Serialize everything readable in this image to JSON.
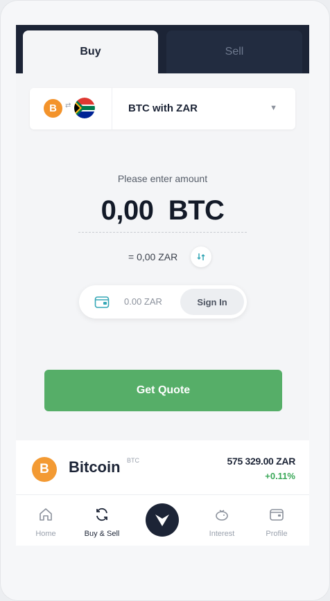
{
  "tabs": {
    "buy": "Buy",
    "sell": "Sell",
    "active": "buy"
  },
  "pair": {
    "base_symbol": "B",
    "label": "BTC with ZAR",
    "caret": "▼",
    "base_icon": "bitcoin-icon",
    "quote_icon": "south-africa-flag-icon"
  },
  "amount": {
    "prompt": "Please enter amount",
    "value": "0,00",
    "unit": "BTC",
    "converted": "= 0,00 ZAR"
  },
  "wallet": {
    "balance": "0.00 ZAR",
    "signin": "Sign In"
  },
  "actions": {
    "get_quote": "Get Quote"
  },
  "ticker": {
    "coin_symbol": "B",
    "name": "Bitcoin",
    "symbol": "BTC",
    "price": "575 329.00 ZAR",
    "change": "+0.11%"
  },
  "nav": {
    "items": [
      {
        "label": "Home",
        "icon": "home-icon"
      },
      {
        "label": "Buy & Sell",
        "icon": "refresh-icon"
      },
      {
        "label": "Interest",
        "icon": "piggy-bank-icon"
      },
      {
        "label": "Profile",
        "icon": "wallet-icon"
      }
    ],
    "active": "Buy & Sell"
  },
  "colors": {
    "brand_dark": "#1c2436",
    "accent_green": "#56ae68",
    "bitcoin_orange": "#f3932b",
    "positive": "#3aa858"
  }
}
